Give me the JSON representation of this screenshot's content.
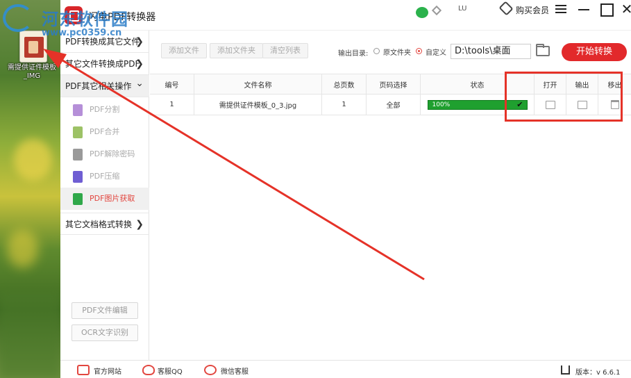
{
  "watermark": {
    "title": "河东软件园",
    "url": "www.pc0359.cn"
  },
  "desktop": {
    "icon_label": "需提供证件模板_IMG"
  },
  "titlebar": {
    "app_title": "闪电PDF转换器",
    "user": "LU",
    "buy_label": "购买会员",
    "close_glyph": "✕"
  },
  "sidebar": {
    "groups": [
      {
        "label": "PDF转换成其它文件",
        "chevron": "❯"
      },
      {
        "label": "其它文件转换成PDF",
        "chevron": "❯"
      },
      {
        "label": "PDF其它相关操作",
        "chevron": "⌄"
      }
    ],
    "subitems": [
      {
        "label": "PDF分割",
        "color": "#b58fd8"
      },
      {
        "label": "PDF合并",
        "color": "#9dc266"
      },
      {
        "label": "PDF解除密码",
        "color": "#9a9a9a"
      },
      {
        "label": "PDF压缩",
        "color": "#6f5ed3"
      },
      {
        "label": "PDF图片获取",
        "color": "#2fa84a"
      }
    ],
    "other_group": {
      "label": "其它文档格式转换",
      "chevron": "❯"
    },
    "tools": [
      "PDF文件编辑",
      "OCR文字识别"
    ]
  },
  "toolbar": {
    "add_file": "添加文件",
    "add_folder": "添加文件夹",
    "clear_list": "清空列表",
    "output_label": "输出目录:",
    "radio_source": "原文件夹",
    "radio_custom": "自定义",
    "path": "D:\\tools\\桌面",
    "start": "开始转换"
  },
  "table": {
    "headers": [
      "编号",
      "文件名称",
      "总页数",
      "页码选择",
      "状态",
      "打开",
      "输出",
      "移出"
    ],
    "rows": [
      {
        "index": "1",
        "filename": "需提供证件模板_0_3.jpg",
        "pages": "1",
        "range": "全部",
        "status": "100%",
        "progress": 1.0
      }
    ]
  },
  "footer": {
    "website": "官方网站",
    "qq": "客服QQ",
    "wechat": "微信客服",
    "version": "版本：v 6.6.1"
  },
  "colors": {
    "accent": "#e2292b",
    "progress": "#1fa02f",
    "highlight": "#e53228"
  }
}
